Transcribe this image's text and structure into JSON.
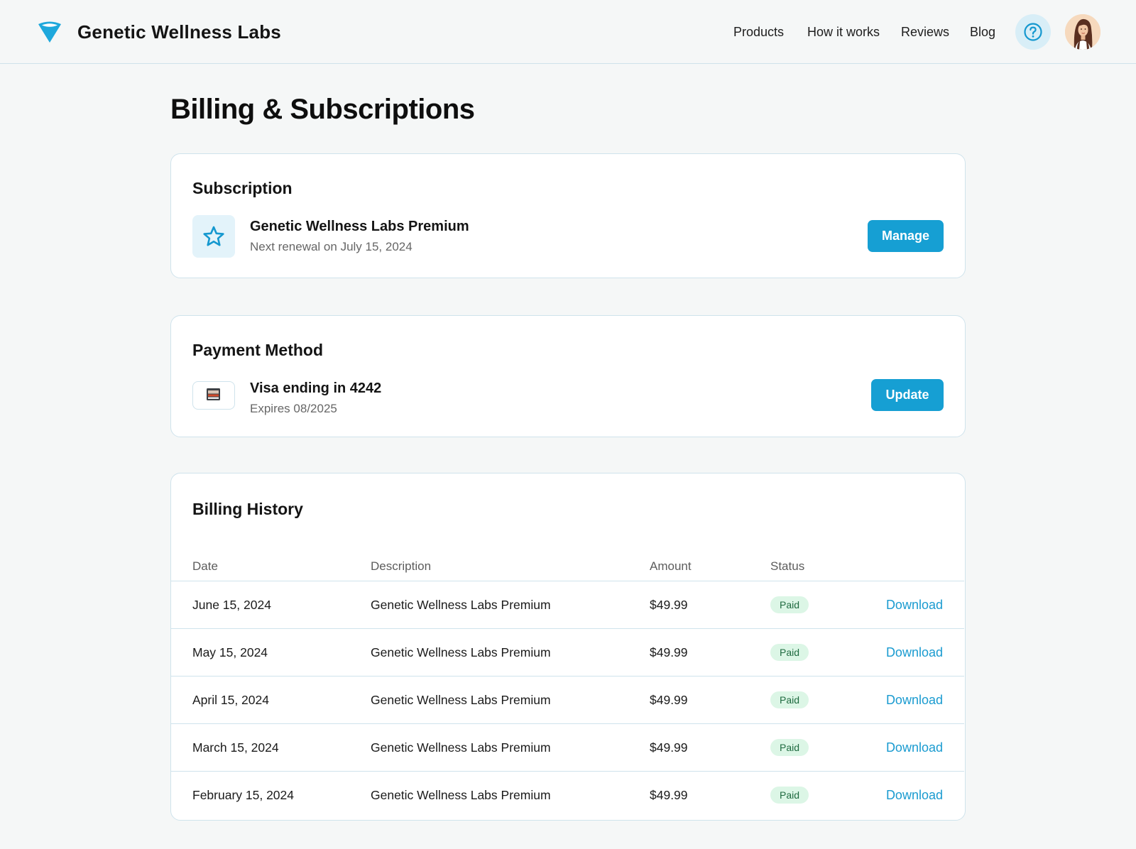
{
  "header": {
    "brand": "Genetic Wellness Labs",
    "nav": [
      "Products",
      "How it works",
      "Reviews",
      "Blog"
    ],
    "help_icon": "question-circle-icon",
    "avatar_icon": "user-avatar-portrait"
  },
  "page": {
    "title": "Billing & Subscriptions"
  },
  "subscription": {
    "heading": "Subscription",
    "icon": "star-icon",
    "plan_name": "Genetic Wellness Labs Premium",
    "renewal": "Next renewal on July 15, 2024",
    "button": "Manage"
  },
  "payment": {
    "heading": "Payment Method",
    "icon": "credit-card-icon",
    "card_label": "Visa ending in 4242",
    "expiry": "Expires 08/2025",
    "button": "Update"
  },
  "history": {
    "heading": "Billing History",
    "columns": [
      "Date",
      "Description",
      "Amount",
      "Status"
    ],
    "rows": [
      {
        "date": "June 15, 2024",
        "description": "Genetic Wellness Labs Premium",
        "amount": "$49.99",
        "status": "Paid",
        "action": "Download"
      },
      {
        "date": "May 15, 2024",
        "description": "Genetic Wellness Labs Premium",
        "amount": "$49.99",
        "status": "Paid",
        "action": "Download"
      },
      {
        "date": "April 15, 2024",
        "description": "Genetic Wellness Labs Premium",
        "amount": "$49.99",
        "status": "Paid",
        "action": "Download"
      },
      {
        "date": "March 15, 2024",
        "description": "Genetic Wellness Labs Premium",
        "amount": "$49.99",
        "status": "Paid",
        "action": "Download"
      },
      {
        "date": "February 15, 2024",
        "description": "Genetic Wellness Labs Premium",
        "amount": "$49.99",
        "status": "Paid",
        "action": "Download"
      }
    ]
  },
  "colors": {
    "accent": "#169fd3",
    "background": "#f5f7f7",
    "border": "#cfe3ec",
    "paid_badge_bg": "#dcf6e6",
    "paid_badge_text": "#1f6b40"
  }
}
